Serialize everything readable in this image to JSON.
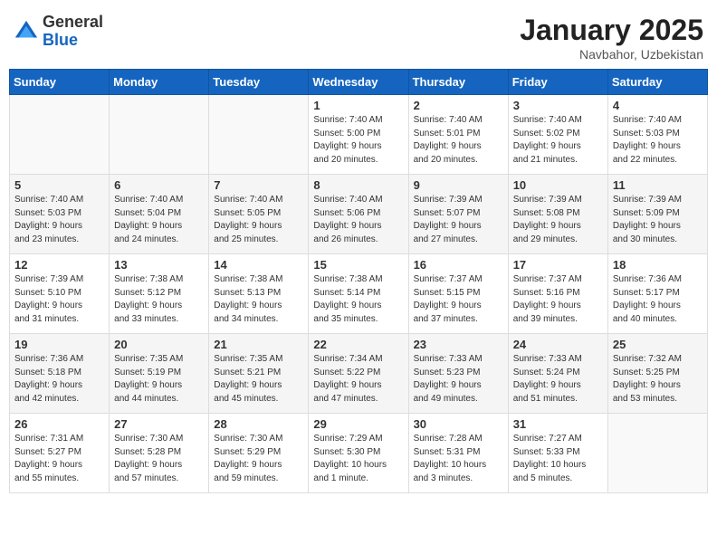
{
  "header": {
    "logo_general": "General",
    "logo_blue": "Blue",
    "month_year": "January 2025",
    "location": "Navbahor, Uzbekistan"
  },
  "days_of_week": [
    "Sunday",
    "Monday",
    "Tuesday",
    "Wednesday",
    "Thursday",
    "Friday",
    "Saturday"
  ],
  "weeks": [
    [
      {
        "num": "",
        "info": ""
      },
      {
        "num": "",
        "info": ""
      },
      {
        "num": "",
        "info": ""
      },
      {
        "num": "1",
        "info": "Sunrise: 7:40 AM\nSunset: 5:00 PM\nDaylight: 9 hours\nand 20 minutes."
      },
      {
        "num": "2",
        "info": "Sunrise: 7:40 AM\nSunset: 5:01 PM\nDaylight: 9 hours\nand 20 minutes."
      },
      {
        "num": "3",
        "info": "Sunrise: 7:40 AM\nSunset: 5:02 PM\nDaylight: 9 hours\nand 21 minutes."
      },
      {
        "num": "4",
        "info": "Sunrise: 7:40 AM\nSunset: 5:03 PM\nDaylight: 9 hours\nand 22 minutes."
      }
    ],
    [
      {
        "num": "5",
        "info": "Sunrise: 7:40 AM\nSunset: 5:03 PM\nDaylight: 9 hours\nand 23 minutes."
      },
      {
        "num": "6",
        "info": "Sunrise: 7:40 AM\nSunset: 5:04 PM\nDaylight: 9 hours\nand 24 minutes."
      },
      {
        "num": "7",
        "info": "Sunrise: 7:40 AM\nSunset: 5:05 PM\nDaylight: 9 hours\nand 25 minutes."
      },
      {
        "num": "8",
        "info": "Sunrise: 7:40 AM\nSunset: 5:06 PM\nDaylight: 9 hours\nand 26 minutes."
      },
      {
        "num": "9",
        "info": "Sunrise: 7:39 AM\nSunset: 5:07 PM\nDaylight: 9 hours\nand 27 minutes."
      },
      {
        "num": "10",
        "info": "Sunrise: 7:39 AM\nSunset: 5:08 PM\nDaylight: 9 hours\nand 29 minutes."
      },
      {
        "num": "11",
        "info": "Sunrise: 7:39 AM\nSunset: 5:09 PM\nDaylight: 9 hours\nand 30 minutes."
      }
    ],
    [
      {
        "num": "12",
        "info": "Sunrise: 7:39 AM\nSunset: 5:10 PM\nDaylight: 9 hours\nand 31 minutes."
      },
      {
        "num": "13",
        "info": "Sunrise: 7:38 AM\nSunset: 5:12 PM\nDaylight: 9 hours\nand 33 minutes."
      },
      {
        "num": "14",
        "info": "Sunrise: 7:38 AM\nSunset: 5:13 PM\nDaylight: 9 hours\nand 34 minutes."
      },
      {
        "num": "15",
        "info": "Sunrise: 7:38 AM\nSunset: 5:14 PM\nDaylight: 9 hours\nand 35 minutes."
      },
      {
        "num": "16",
        "info": "Sunrise: 7:37 AM\nSunset: 5:15 PM\nDaylight: 9 hours\nand 37 minutes."
      },
      {
        "num": "17",
        "info": "Sunrise: 7:37 AM\nSunset: 5:16 PM\nDaylight: 9 hours\nand 39 minutes."
      },
      {
        "num": "18",
        "info": "Sunrise: 7:36 AM\nSunset: 5:17 PM\nDaylight: 9 hours\nand 40 minutes."
      }
    ],
    [
      {
        "num": "19",
        "info": "Sunrise: 7:36 AM\nSunset: 5:18 PM\nDaylight: 9 hours\nand 42 minutes."
      },
      {
        "num": "20",
        "info": "Sunrise: 7:35 AM\nSunset: 5:19 PM\nDaylight: 9 hours\nand 44 minutes."
      },
      {
        "num": "21",
        "info": "Sunrise: 7:35 AM\nSunset: 5:21 PM\nDaylight: 9 hours\nand 45 minutes."
      },
      {
        "num": "22",
        "info": "Sunrise: 7:34 AM\nSunset: 5:22 PM\nDaylight: 9 hours\nand 47 minutes."
      },
      {
        "num": "23",
        "info": "Sunrise: 7:33 AM\nSunset: 5:23 PM\nDaylight: 9 hours\nand 49 minutes."
      },
      {
        "num": "24",
        "info": "Sunrise: 7:33 AM\nSunset: 5:24 PM\nDaylight: 9 hours\nand 51 minutes."
      },
      {
        "num": "25",
        "info": "Sunrise: 7:32 AM\nSunset: 5:25 PM\nDaylight: 9 hours\nand 53 minutes."
      }
    ],
    [
      {
        "num": "26",
        "info": "Sunrise: 7:31 AM\nSunset: 5:27 PM\nDaylight: 9 hours\nand 55 minutes."
      },
      {
        "num": "27",
        "info": "Sunrise: 7:30 AM\nSunset: 5:28 PM\nDaylight: 9 hours\nand 57 minutes."
      },
      {
        "num": "28",
        "info": "Sunrise: 7:30 AM\nSunset: 5:29 PM\nDaylight: 9 hours\nand 59 minutes."
      },
      {
        "num": "29",
        "info": "Sunrise: 7:29 AM\nSunset: 5:30 PM\nDaylight: 10 hours\nand 1 minute."
      },
      {
        "num": "30",
        "info": "Sunrise: 7:28 AM\nSunset: 5:31 PM\nDaylight: 10 hours\nand 3 minutes."
      },
      {
        "num": "31",
        "info": "Sunrise: 7:27 AM\nSunset: 5:33 PM\nDaylight: 10 hours\nand 5 minutes."
      },
      {
        "num": "",
        "info": ""
      }
    ]
  ]
}
